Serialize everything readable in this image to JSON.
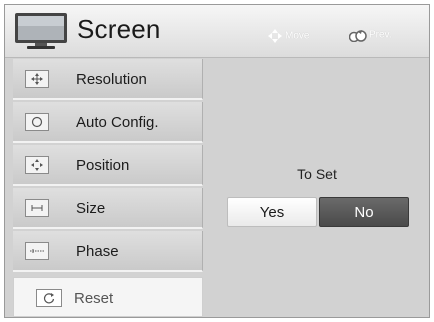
{
  "header": {
    "title": "Screen",
    "hints": {
      "move_label": "Move",
      "prev_label": "Prev."
    },
    "icons": {
      "title_icon": "tv-screen-icon",
      "move_icon": "four-arrows-icon",
      "prev_icon": "return-icon"
    }
  },
  "menu": {
    "items": [
      {
        "label": "Resolution",
        "icon": "resolution-icon"
      },
      {
        "label": "Auto Config.",
        "icon": "auto-config-icon"
      },
      {
        "label": "Position",
        "icon": "position-icon"
      },
      {
        "label": "Size",
        "icon": "size-icon"
      },
      {
        "label": "Phase",
        "icon": "phase-icon"
      }
    ],
    "reset": {
      "label": "Reset",
      "icon": "reset-icon"
    }
  },
  "dialog": {
    "prompt": "To Set",
    "yes_label": "Yes",
    "no_label": "No",
    "selected": "No"
  },
  "colors": {
    "panel": "#d2d2d2",
    "selected_button": "#555555",
    "highlight_item": "#f5f5f5"
  }
}
